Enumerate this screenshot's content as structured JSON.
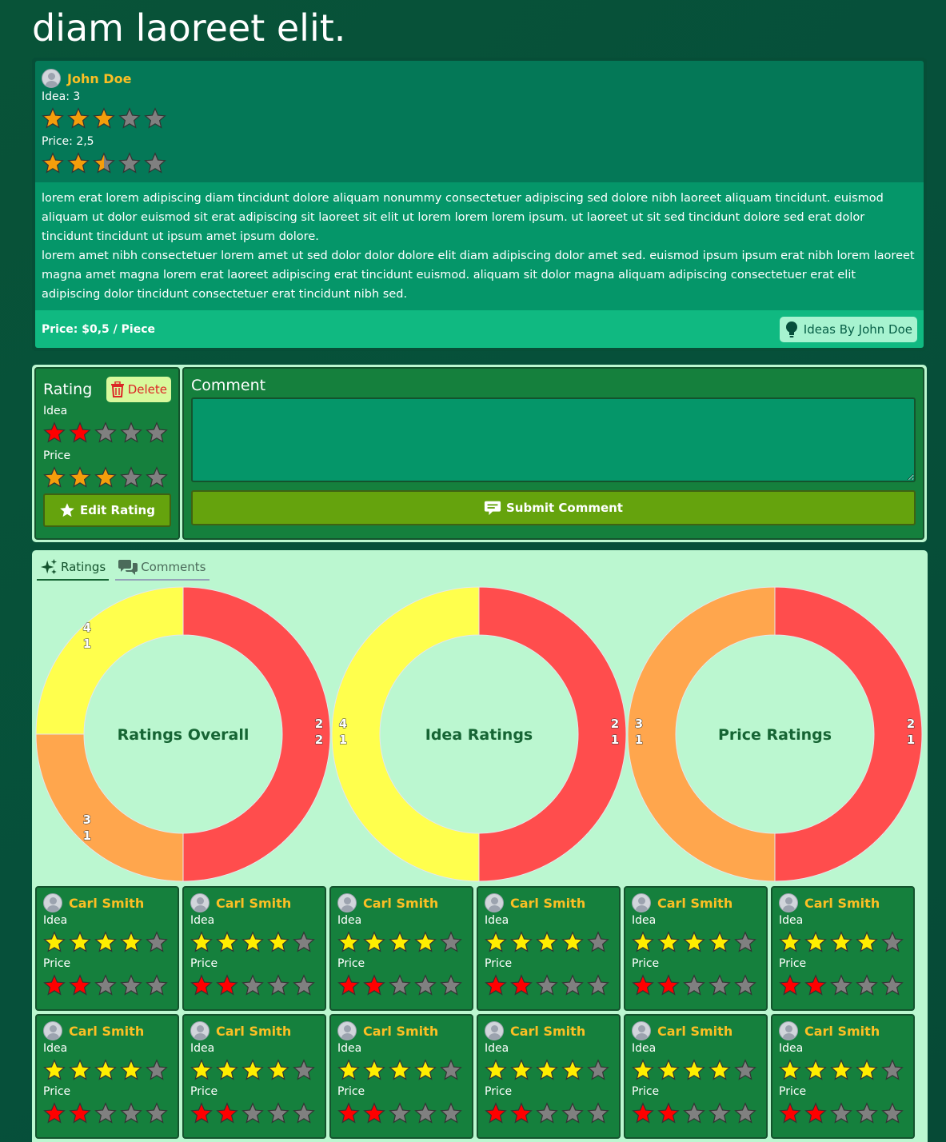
{
  "page": {
    "title": "diam laoreet elit."
  },
  "idea": {
    "author": "John Doe",
    "idea_label": "Idea: 3",
    "idea_rating": 3,
    "price_label": "Price: 2,5",
    "price_rating": 2.5,
    "description_1": "lorem erat lorem adipiscing diam tincidunt dolore aliquam nonummy consectetuer adipiscing sed dolore nibh laoreet aliquam tincidunt. euismod aliquam ut dolor euismod sit erat adipiscing sit laoreet sit elit ut lorem lorem lorem ipsum. ut laoreet ut sit sed tincidunt dolore sed erat dolor tincidunt tincidunt ut ipsum amet ipsum dolore.",
    "description_2": "lorem amet nibh consectetuer lorem amet ut sed dolor dolor dolore elit diam adipiscing dolor amet sed. euismod ipsum ipsum erat nibh lorem laoreet magna amet magna lorem erat laoreet adipiscing erat tincidunt euismod. aliquam sit dolor magna aliquam adipiscing consectetuer erat elit adipiscing dolor tincidunt consectetuer erat tincidunt nibh sed.",
    "price_text": "Price: $0,5 / Piece",
    "ideas_by_label": "Ideas By John Doe"
  },
  "my_rating": {
    "title": "Rating",
    "delete_label": "Delete",
    "idea_label": "Idea",
    "idea_value": 2,
    "price_label": "Price",
    "price_value": 3,
    "edit_label": "Edit Rating"
  },
  "comment": {
    "title": "Comment",
    "value": "",
    "placeholder": "",
    "submit_label": "Submit Comment"
  },
  "tabs": [
    {
      "label": "Ratings",
      "icon": "sparkles-icon",
      "active": true
    },
    {
      "label": "Comments",
      "icon": "chat-bubbles-icon",
      "active": false
    }
  ],
  "chart_data": [
    {
      "type": "pie",
      "title": "Ratings Overall",
      "segments": [
        {
          "rating": "2",
          "count": "2",
          "value": 2,
          "color": "#ff4d4d"
        },
        {
          "rating": "3",
          "count": "1",
          "value": 1,
          "color": "#ffa64d"
        },
        {
          "rating": "4",
          "count": "1",
          "value": 1,
          "color": "#ffff4d"
        }
      ]
    },
    {
      "type": "pie",
      "title": "Idea Ratings",
      "segments": [
        {
          "rating": "2",
          "count": "1",
          "value": 1,
          "color": "#ff4d4d"
        },
        {
          "rating": "4",
          "count": "1",
          "value": 1,
          "color": "#ffff4d"
        }
      ]
    },
    {
      "type": "pie",
      "title": "Price Ratings",
      "segments": [
        {
          "rating": "2",
          "count": "1",
          "value": 1,
          "color": "#ff4d4d"
        },
        {
          "rating": "3",
          "count": "1",
          "value": 1,
          "color": "#ffa64d"
        }
      ]
    }
  ],
  "reviews": [
    {
      "author": "Carl Smith",
      "idea_label": "Idea",
      "idea": 4,
      "price_label": "Price",
      "price": 2
    },
    {
      "author": "Carl Smith",
      "idea_label": "Idea",
      "idea": 4,
      "price_label": "Price",
      "price": 2
    },
    {
      "author": "Carl Smith",
      "idea_label": "Idea",
      "idea": 4,
      "price_label": "Price",
      "price": 2
    },
    {
      "author": "Carl Smith",
      "idea_label": "Idea",
      "idea": 4,
      "price_label": "Price",
      "price": 2
    },
    {
      "author": "Carl Smith",
      "idea_label": "Idea",
      "idea": 4,
      "price_label": "Price",
      "price": 2
    },
    {
      "author": "Carl Smith",
      "idea_label": "Idea",
      "idea": 4,
      "price_label": "Price",
      "price": 2
    },
    {
      "author": "Carl Smith",
      "idea_label": "Idea",
      "idea": 4,
      "price_label": "Price",
      "price": 2
    },
    {
      "author": "Carl Smith",
      "idea_label": "Idea",
      "idea": 4,
      "price_label": "Price",
      "price": 2
    },
    {
      "author": "Carl Smith",
      "idea_label": "Idea",
      "idea": 4,
      "price_label": "Price",
      "price": 2
    },
    {
      "author": "Carl Smith",
      "idea_label": "Idea",
      "idea": 4,
      "price_label": "Price",
      "price": 2
    },
    {
      "author": "Carl Smith",
      "idea_label": "Idea",
      "idea": 4,
      "price_label": "Price",
      "price": 2
    },
    {
      "author": "Carl Smith",
      "idea_label": "Idea",
      "idea": 4,
      "price_label": "Price",
      "price": 2
    }
  ],
  "colors": {
    "star_orange": "#f59e0b",
    "star_yellow": "#ffee00",
    "star_red": "#ff0000",
    "star_empty": "#808080",
    "author_name": "#fbbf24"
  }
}
